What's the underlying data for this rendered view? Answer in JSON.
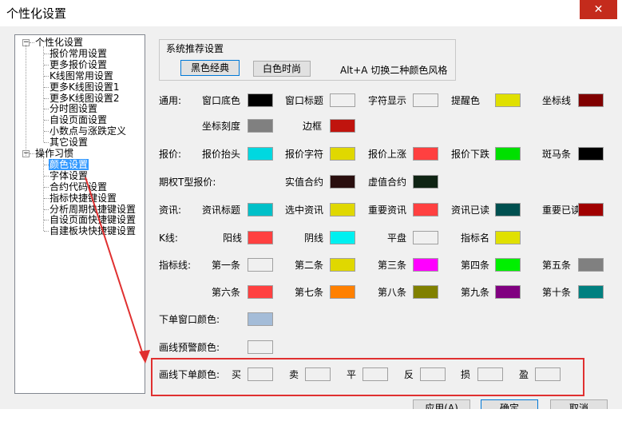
{
  "window": {
    "title": "个性化设置",
    "close_glyph": "✕"
  },
  "tree": {
    "groups": [
      {
        "label": "个性化设置",
        "toggle": "−",
        "children": [
          "报价常用设置",
          "更多报价设置",
          "K线图常用设置",
          "更多K线图设置1",
          "更多K线图设置2",
          "分时图设置",
          "自设页面设置",
          "小数点与涨跌定义",
          "其它设置"
        ]
      },
      {
        "label": "操作习惯",
        "toggle": "−",
        "children": [
          "颜色设置",
          "字体设置",
          "合约代码设置",
          "指标快捷键设置",
          "分析周期快捷键设置",
          "自设页面快捷键设置",
          "自建板块快捷键设置"
        ]
      }
    ],
    "selected": "颜色设置"
  },
  "recommend": {
    "title": "系统推荐设置",
    "black_label": "黑色经典",
    "white_label": "白色时尚",
    "hint": "Alt+A 切换二种颜色风格"
  },
  "colors": {
    "general": {
      "heading": "通用:",
      "items": [
        {
          "label": "窗口底色",
          "color": "#000000"
        },
        {
          "label": "窗口标题",
          "color": "#f0f0f0"
        },
        {
          "label": "字符显示",
          "color": "#f0f0f0"
        },
        {
          "label": "提醒色",
          "color": "#e0e000"
        },
        {
          "label": "坐标线",
          "color": "#800000"
        },
        {
          "label": "坐标刻度",
          "color": "#808080"
        },
        {
          "label": "边框",
          "color": "#c0140e"
        }
      ]
    },
    "quote": {
      "heading": "报价:",
      "items": [
        {
          "label": "报价抬头",
          "color": "#00d8e0"
        },
        {
          "label": "报价字符",
          "color": "#e0d800"
        },
        {
          "label": "报价上涨",
          "color": "#ff4040"
        },
        {
          "label": "报价下跌",
          "color": "#00e000"
        },
        {
          "label": "斑马条",
          "color": "#000000"
        }
      ]
    },
    "option": {
      "heading": "期权T型报价:",
      "items": [
        {
          "label": "实值合约",
          "color": "#2a0f0f"
        },
        {
          "label": "虚值合约",
          "color": "#0f2414"
        }
      ]
    },
    "news": {
      "heading": "资讯:",
      "items": [
        {
          "label": "资讯标题",
          "color": "#00c0c8"
        },
        {
          "label": "选中资讯",
          "color": "#e0d800"
        },
        {
          "label": "重要资讯",
          "color": "#ff4040"
        },
        {
          "label": "资讯已读",
          "color": "#005050"
        },
        {
          "label": "重要已读",
          "color": "#a00000"
        }
      ]
    },
    "kline": {
      "heading": "K线:",
      "items": [
        {
          "label": "阳线",
          "color": "#ff4040"
        },
        {
          "label": "阴线",
          "color": "#00f0f0"
        },
        {
          "label": "平盘",
          "color": "#f0f0f0"
        },
        {
          "label": "指标名",
          "color": "#e0e000"
        }
      ]
    },
    "indicator": {
      "heading": "指标线:",
      "items": [
        {
          "label": "第一条",
          "color": "#f0f0f0"
        },
        {
          "label": "第二条",
          "color": "#e0d800"
        },
        {
          "label": "第三条",
          "color": "#ff00ff"
        },
        {
          "label": "第四条",
          "color": "#00f000"
        },
        {
          "label": "第五条",
          "color": "#808080"
        },
        {
          "label": "第六条",
          "color": "#ff4040"
        },
        {
          "label": "第七条",
          "color": "#ff8000"
        },
        {
          "label": "第八条",
          "color": "#808000"
        },
        {
          "label": "第九条",
          "color": "#800080"
        },
        {
          "label": "第十条",
          "color": "#008080"
        }
      ]
    },
    "order_window": {
      "label": "下单窗口颜色:",
      "color": "#a4bcd8"
    },
    "line_warning": {
      "label": "画线预警颜色:",
      "color": "#f0f0f0"
    },
    "line_order": {
      "label": "画线下单颜色:",
      "items": [
        {
          "label": "买",
          "color": "#f0f0f0"
        },
        {
          "label": "卖",
          "color": "#f0f0f0"
        },
        {
          "label": "平",
          "color": "#f0f0f0"
        },
        {
          "label": "反",
          "color": "#f0f0f0"
        },
        {
          "label": "损",
          "color": "#f0f0f0"
        },
        {
          "label": "盈",
          "color": "#f0f0f0"
        }
      ]
    }
  },
  "buttons": {
    "apply": "应用(A)",
    "ok": "确定",
    "cancel": "取消"
  },
  "annotation": {
    "color": "#e03030"
  }
}
